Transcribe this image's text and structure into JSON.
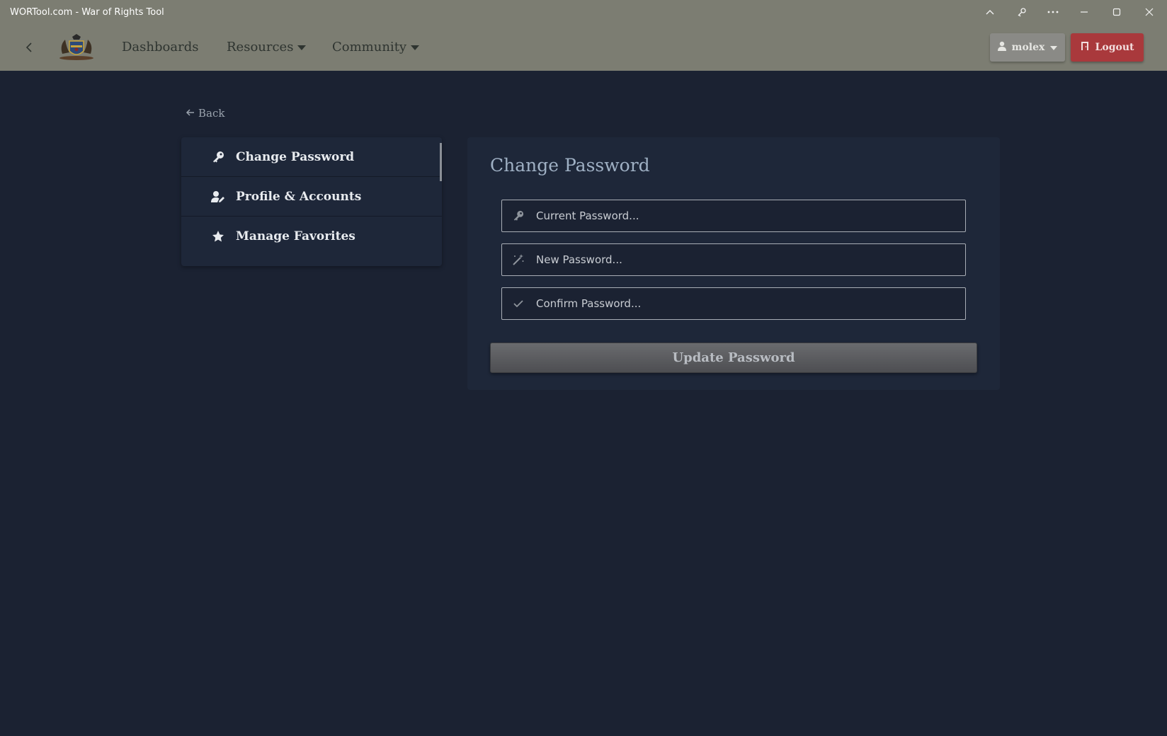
{
  "window": {
    "title": "WORTool.com - War of Rights Tool",
    "controls": [
      "chevron-up-icon",
      "extensions-icon",
      "more-icon",
      "minimize-icon",
      "maximize-icon",
      "close-icon"
    ]
  },
  "navbar": {
    "back_icon": "chevron-left-icon",
    "logo": "coat-of-arms-logo",
    "links": [
      {
        "label": "Dashboards",
        "dropdown": false
      },
      {
        "label": "Resources",
        "dropdown": true
      },
      {
        "label": "Community",
        "dropdown": true
      }
    ],
    "user": {
      "label": "molex",
      "icon": "user-icon"
    },
    "logout": {
      "label": "Logout",
      "icon": "door-icon",
      "color": "#a9393c"
    }
  },
  "back_link": {
    "label": "Back",
    "icon": "arrow-left-icon"
  },
  "sidebar": {
    "items": [
      {
        "label": "Change Password",
        "icon": "key-icon",
        "active": true
      },
      {
        "label": "Profile & Accounts",
        "icon": "user-edit-icon",
        "active": false
      },
      {
        "label": "Manage Favorites",
        "icon": "star-icon",
        "active": false
      }
    ]
  },
  "form": {
    "title": "Change Password",
    "fields": [
      {
        "placeholder": "Current Password...",
        "value": "",
        "icon": "key-icon"
      },
      {
        "placeholder": "New Password...",
        "value": "",
        "icon": "magic-wand-icon"
      },
      {
        "placeholder": "Confirm Password...",
        "value": "",
        "icon": "check-icon"
      }
    ],
    "submit_label": "Update Password"
  }
}
